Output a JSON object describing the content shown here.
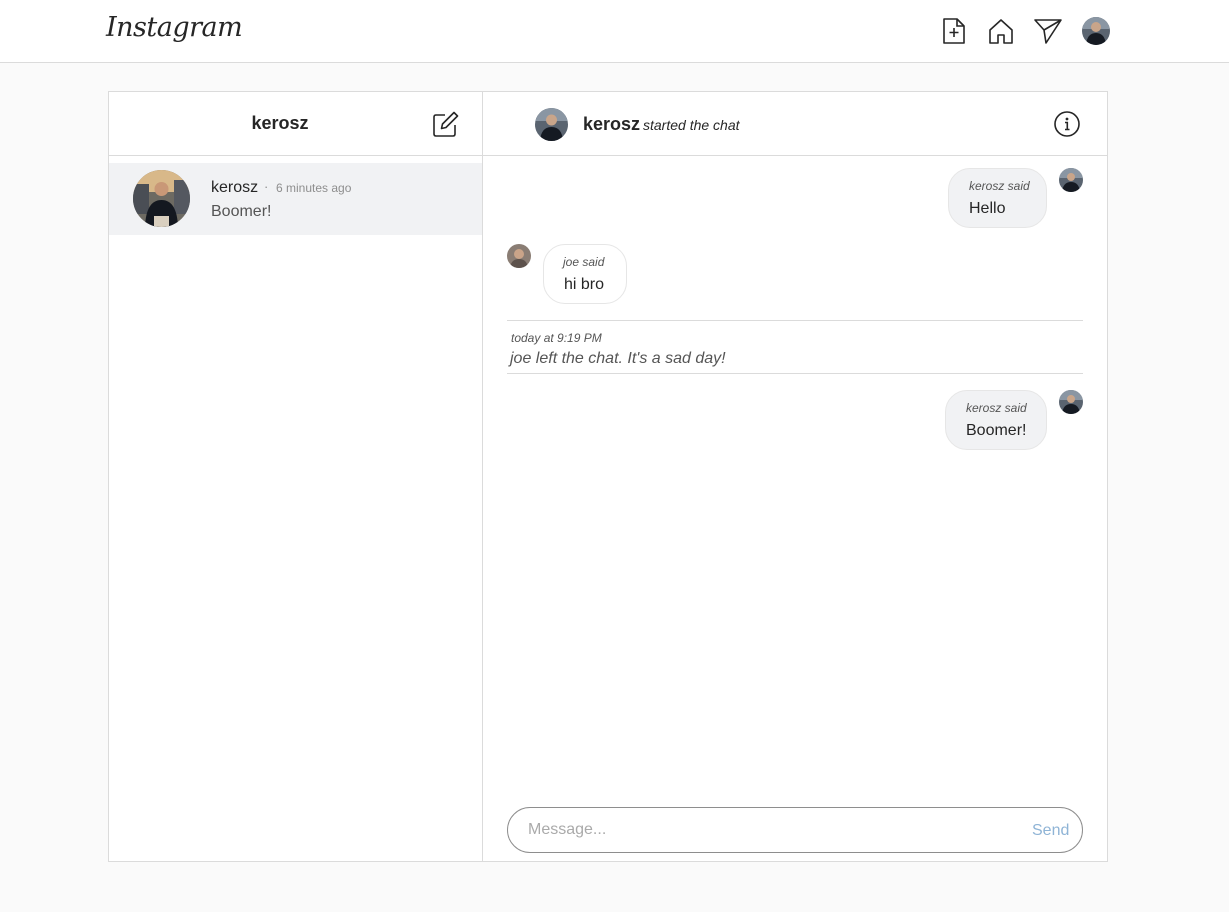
{
  "brand": {
    "logo_text": "Instagram"
  },
  "nav": {
    "icons": [
      "new-post-icon",
      "home-icon",
      "direct-icon"
    ],
    "avatar": "profile-avatar"
  },
  "inbox": {
    "title": "kerosz",
    "compose_icon": "compose-icon",
    "conversations": [
      {
        "name": "kerosz",
        "separator": "·",
        "time": "6 minutes ago",
        "last_message": "Boomer!"
      }
    ]
  },
  "thread": {
    "header": {
      "name": "kerosz",
      "note": "started the chat",
      "info_icon": "info-icon"
    },
    "messages": [
      {
        "said": "kerosz said",
        "text": "Hello",
        "from": "self"
      },
      {
        "said": "joe said",
        "text": "hi bro",
        "from": "other"
      },
      {
        "said": "kerosz said",
        "text": "Boomer!",
        "from": "self"
      }
    ],
    "system": {
      "time": "today at 9:19 PM",
      "text": "joe left the chat. It's a sad day!"
    },
    "composer": {
      "placeholder": "Message...",
      "send_label": "Send"
    }
  },
  "colors": {
    "border": "#dbdbdb",
    "bubble_self": "#f1f2f4",
    "send": "#8fb4d6",
    "background": "#fafafa"
  }
}
